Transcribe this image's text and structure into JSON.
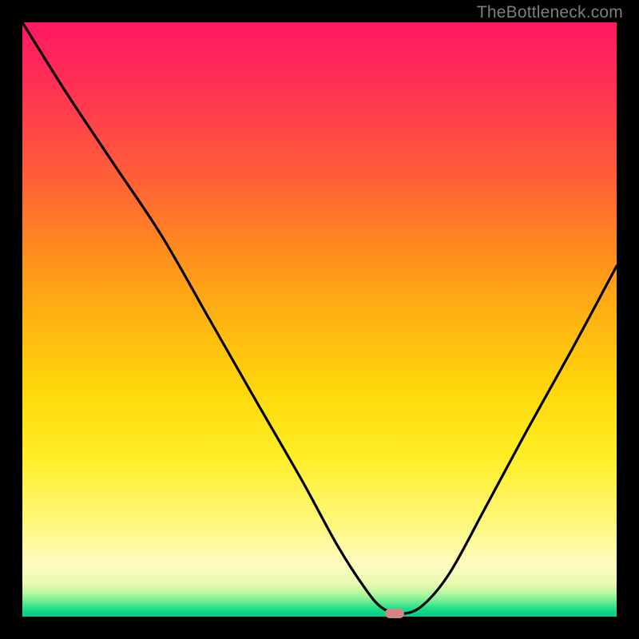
{
  "watermark": "TheBottleneck.com",
  "marker": {
    "x_frac": 0.627,
    "y_frac": 0.994
  },
  "chart_data": {
    "type": "line",
    "title": "",
    "xlabel": "",
    "ylabel": "",
    "xlim": [
      0,
      1
    ],
    "ylim": [
      0,
      1
    ],
    "grid": false,
    "legend": false,
    "series": [
      {
        "name": "curve",
        "x": [
          0.0,
          0.075,
          0.155,
          0.235,
          0.315,
          0.395,
          0.47,
          0.53,
          0.575,
          0.605,
          0.64,
          0.675,
          0.72,
          0.78,
          0.85,
          0.925,
          1.0
        ],
        "y": [
          1.0,
          0.88,
          0.76,
          0.64,
          0.5,
          0.36,
          0.23,
          0.12,
          0.05,
          0.015,
          0.005,
          0.02,
          0.075,
          0.185,
          0.315,
          0.45,
          0.59
        ]
      }
    ],
    "annotations": [
      {
        "type": "marker",
        "shape": "pill",
        "x": 0.627,
        "y": 0.006,
        "color": "#d38586"
      }
    ],
    "background_gradient": {
      "direction": "vertical",
      "stops": [
        {
          "pos": 0.0,
          "color": "#ff1862"
        },
        {
          "pos": 0.5,
          "color": "#ffb412"
        },
        {
          "pos": 0.85,
          "color": "#fffbbf"
        },
        {
          "pos": 1.0,
          "color": "#05ce86"
        }
      ]
    }
  }
}
